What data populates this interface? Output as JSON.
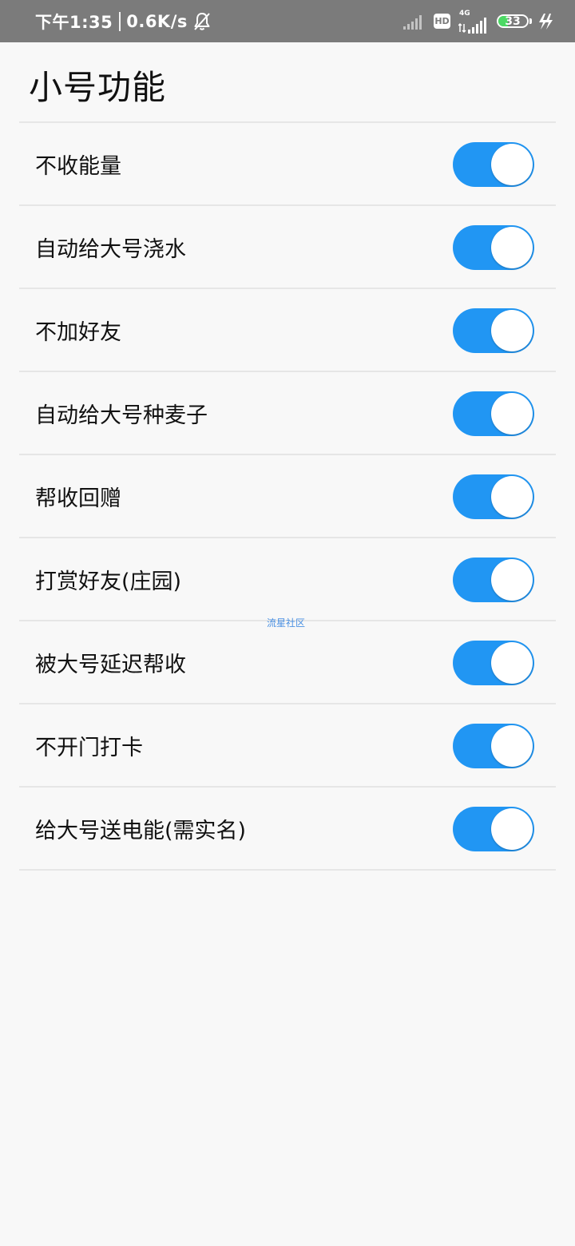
{
  "status_bar": {
    "time": "下午1:35",
    "net_speed": "0.6K/s",
    "hd_label": "HD",
    "network_type": "4G",
    "battery_level": "33",
    "battery_fraction": 0.33,
    "icons": [
      "bell-muted-icon",
      "signal-icon",
      "hd-icon",
      "signal-4g-icon",
      "battery-icon",
      "charging-icon"
    ]
  },
  "page": {
    "title": "小号功能"
  },
  "settings": [
    {
      "label": "不收能量",
      "enabled": true
    },
    {
      "label": "自动给大号浇水",
      "enabled": true
    },
    {
      "label": "不加好友",
      "enabled": true
    },
    {
      "label": "自动给大号种麦子",
      "enabled": true
    },
    {
      "label": "帮收回赠",
      "enabled": true
    },
    {
      "label": "打赏好友(庄园)",
      "enabled": true
    },
    {
      "label": "被大号延迟帮收",
      "enabled": true
    },
    {
      "label": "不开门打卡",
      "enabled": true
    },
    {
      "label": "给大号送电能(需实名)",
      "enabled": true
    }
  ],
  "watermark": "流星社区",
  "colors": {
    "accent": "#2196f3",
    "status_bar": "#7b7b7b",
    "battery_fill": "#4cd964",
    "background": "#f8f8f8"
  }
}
